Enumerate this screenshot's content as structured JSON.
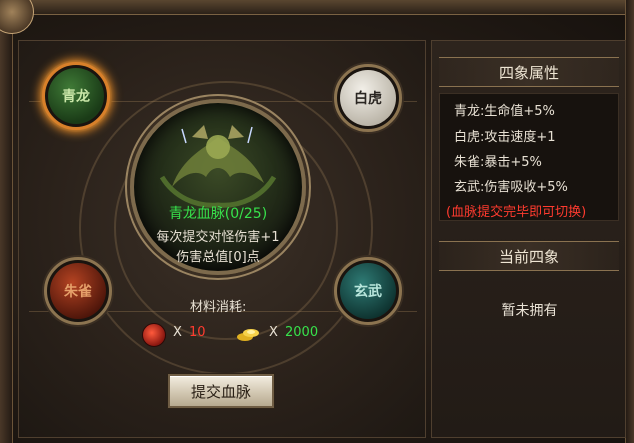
{
  "beasts": {
    "qinglong": "青龙",
    "baihu": "白虎",
    "zhuque": "朱雀",
    "xuanwu": "玄武"
  },
  "bloodline": {
    "title": "青龙血脉(0/25)",
    "desc": "每次提交对怪伤害+1",
    "total": "伤害总值[0]点"
  },
  "materials": {
    "label": "材料消耗:",
    "items": [
      {
        "icon": "blood-orb-icon",
        "x": "X",
        "value": "10",
        "color": "#ff3b2f"
      },
      {
        "icon": "gold-ingot-icon",
        "x": "X",
        "value": "2000",
        "color": "#37e24b"
      }
    ]
  },
  "submit_label": "提交血脉",
  "attributes": {
    "header": "四象属性",
    "lines": [
      "青龙:生命值+5%",
      "白虎:攻击速度+1",
      "朱雀:暴击+5%",
      "玄武:伤害吸收+5%"
    ],
    "note": "(血脉提交完毕即可切换)"
  },
  "current": {
    "header": "当前四象",
    "value": "暂未拥有"
  }
}
